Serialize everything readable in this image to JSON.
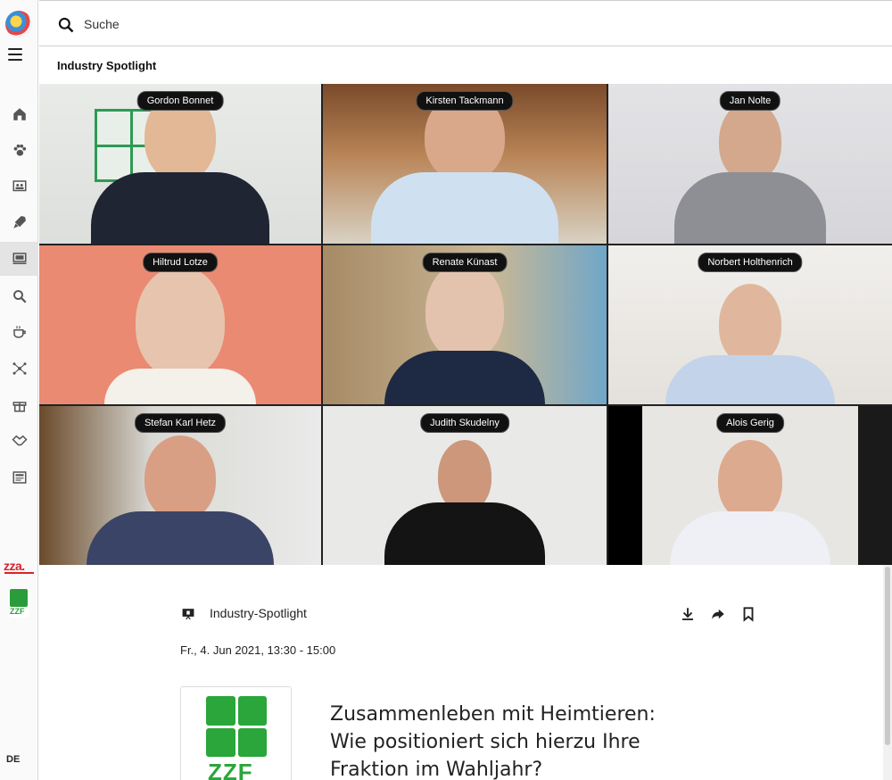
{
  "topbar": {
    "search_label": "Suche"
  },
  "page_title": "Industry Spotlight",
  "sidebar": {
    "items": [
      "home-icon",
      "paw-icon",
      "people-board-icon",
      "rocket-icon",
      "stage-icon",
      "search-zoom-icon",
      "coffee-icon",
      "network-icon",
      "gift-icon",
      "handshake-icon",
      "news-icon"
    ],
    "active_index": 4,
    "brand_zza": "zza.",
    "brand_zzf": "ZZF",
    "language": "DE"
  },
  "participants": [
    {
      "name": "Gordon Bonnet"
    },
    {
      "name": "Kirsten Tackmann"
    },
    {
      "name": "Jan Nolte"
    },
    {
      "name": "Hiltrud Lotze"
    },
    {
      "name": "Renate Künast"
    },
    {
      "name": "Norbert Holthenrich"
    },
    {
      "name": "Stefan Karl Hetz"
    },
    {
      "name": "Judith Skudelny"
    },
    {
      "name": "Alois Gerig"
    }
  ],
  "event": {
    "type_label": "Industry-Spotlight",
    "date": "Fr., 4. Jun 2021, 13:30 - 15:00",
    "title_line1": "Zusammenleben mit Heimtieren:",
    "title_line2": "Wie positioniert sich hierzu Ihre",
    "title_line3": "Fraktion im Wahljahr?",
    "card_logo_text": "ZZF"
  },
  "colors": {
    "accent_green": "#2aa63a",
    "brand_red": "#d8232a"
  }
}
